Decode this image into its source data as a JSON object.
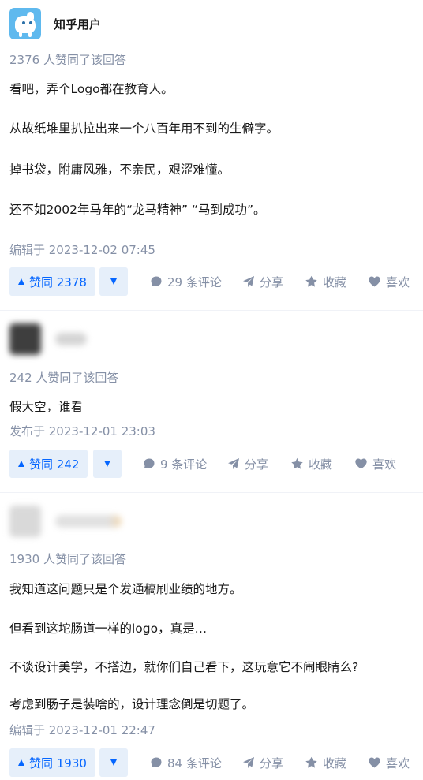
{
  "colors": {
    "accent": "#0566ff",
    "vote_bg": "#e6effa",
    "meta_gray": "#8590a6",
    "text": "#1a1a1a"
  },
  "answers": [
    {
      "author": {
        "name": "知乎用户",
        "avatar": "blue-cartoon-avatar"
      },
      "vote_count_text": "2376 人赞同了该回答",
      "paragraphs": [
        "看吧，弄个Logo都在教育人。",
        "从故纸堆里扒拉出来一个八百年用不到的生僻字。",
        "掉书袋，附庸风雅，不亲民，艰涩难懂。",
        "还不如2002年马年的“龙马精神” “马到成功”。"
      ],
      "timestamp": "编辑于 2023-12-02 07:45",
      "actions": {
        "upvote": "赞同 2378",
        "comments": "29 条评论",
        "share": "分享",
        "collect": "收藏",
        "like": "喜欢"
      }
    },
    {
      "author": {
        "name": "",
        "avatar": "blurred-avatar"
      },
      "vote_count_text": "242 人赞同了该回答",
      "paragraphs": [
        "假大空，谁看"
      ],
      "timestamp": "发布于 2023-12-01 23:03",
      "actions": {
        "upvote": "赞同 242",
        "comments": "9 条评论",
        "share": "分享",
        "collect": "收藏",
        "like": "喜欢"
      }
    },
    {
      "author": {
        "name": "",
        "avatar": "blurred-avatar"
      },
      "vote_count_text": "1930 人赞同了该回答",
      "paragraphs": [
        "我知道这问题只是个发通稿刷业绩的地方。",
        "但看到这坨肠道一样的logo，真是…",
        "不谈设计美学，不搭边，就你们自己看下，这玩意它不闹眼睛么?",
        "考虑到肠子是装啥的，设计理念倒是切题了。"
      ],
      "timestamp": "编辑于 2023-12-01 22:47",
      "actions": {
        "upvote": "赞同 1930",
        "comments": "84 条评论",
        "share": "分享",
        "collect": "收藏",
        "like": "喜欢"
      }
    }
  ]
}
